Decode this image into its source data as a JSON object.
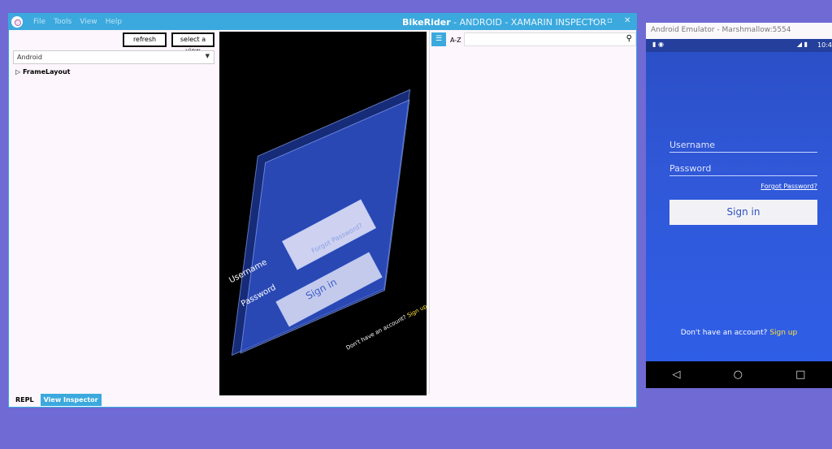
{
  "window": {
    "menu": [
      "File",
      "Tools",
      "View",
      "Help"
    ],
    "app_name": "BikeRider",
    "title_rest": " - ANDROID - XAMARIN INSPECTOR",
    "controls": {
      "minimize": "‒",
      "maximize": "▫",
      "close": "✕"
    }
  },
  "left": {
    "refresh": "refresh",
    "select_view": "select a view",
    "platform": "Android",
    "tree": [
      {
        "label": "FrameLayout",
        "expander": "▷"
      }
    ]
  },
  "right": {
    "az": "A-Z",
    "search_placeholder": ""
  },
  "bottom_tabs": [
    "REPL",
    "View Inspector"
  ],
  "view3d": {
    "username": "Username",
    "password": "Password",
    "signin": "Sign in",
    "forgot": "Forgot Password?",
    "account": "Don't have an account?",
    "signup": "Sign up"
  },
  "emulator": {
    "title": "Android Emulator - Marshmallow:5554",
    "time": "10:4",
    "username": "Username",
    "password": "Password",
    "forgot": "Forgot Password?",
    "signin": "Sign in",
    "account": "Don't have an account?",
    "signup": "Sign up",
    "nav": [
      "◁",
      "○",
      "□"
    ]
  }
}
